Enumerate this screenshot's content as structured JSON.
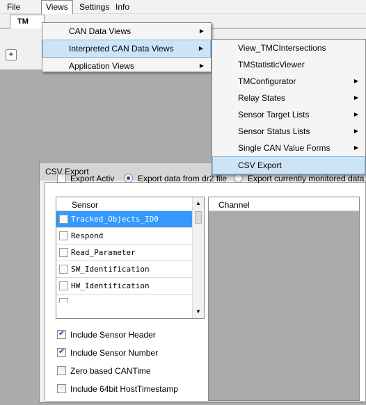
{
  "menubar": {
    "items": [
      "File",
      "Views",
      "Settings",
      "Info"
    ]
  },
  "tab": {
    "label": "TM"
  },
  "toolbar": {
    "add_label": "+"
  },
  "views_menu": {
    "items": [
      {
        "label": "CAN Data Views",
        "submenu": true
      },
      {
        "label": "Interpreted CAN Data Views",
        "submenu": true,
        "highlighted": true
      },
      {
        "label": "Application Views",
        "submenu": true
      }
    ]
  },
  "submenu": {
    "items": [
      {
        "label": "View_TMCIntersections",
        "submenu": false
      },
      {
        "label": "TMStatisticViewer",
        "submenu": false
      },
      {
        "label": "TMConfigurator",
        "submenu": true
      },
      {
        "label": "Relay States",
        "submenu": true
      },
      {
        "label": "Sensor Target Lists",
        "submenu": true
      },
      {
        "label": "Sensor Status Lists",
        "submenu": true
      },
      {
        "label": "Single CAN Value Forms",
        "submenu": true
      },
      {
        "label": "CSV Export",
        "submenu": false,
        "highlighted": true
      }
    ]
  },
  "csv_export": {
    "title": "CSV Export",
    "export_activ": {
      "label": "Export Activ",
      "checked": false
    },
    "radio_dr2": {
      "label": "Export data from dr2 file",
      "selected": true
    },
    "radio_monitored": {
      "label": "Export currently monitored data",
      "selected": false
    },
    "sensor_header": "Sensor",
    "sensors": [
      {
        "name": "Tracked_Objects_ID0",
        "selected": true
      },
      {
        "name": "Respond",
        "selected": false
      },
      {
        "name": "Read_Parameter",
        "selected": false
      },
      {
        "name": "SW_Identification",
        "selected": false
      },
      {
        "name": "HW_Identification",
        "selected": false
      }
    ],
    "channel_header": "Channel",
    "options": [
      {
        "label": "Include Sensor Header",
        "checked": true
      },
      {
        "label": "Include Sensor Number",
        "checked": true
      },
      {
        "label": "Zero based CANTime",
        "checked": false
      },
      {
        "label": "Include 64bit HostTimestamp",
        "checked": false
      }
    ]
  },
  "colors": {
    "selection": "#3399ff",
    "menu_highlight": "#cde4f7",
    "workspace": "#ababab"
  }
}
